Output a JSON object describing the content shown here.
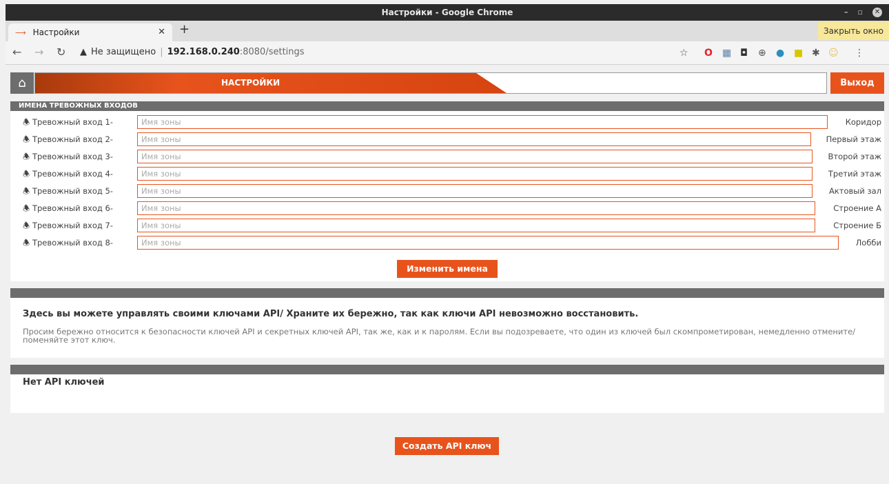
{
  "window": {
    "title": "Настройки - Google Chrome"
  },
  "tab": {
    "label": "Настройки",
    "favicon": "orange-arrow-icon"
  },
  "tabbar": {
    "close_window": "Закрыть окно"
  },
  "address": {
    "security": "Не защищено",
    "host": "192.168.0.240",
    "path": ":8080/settings"
  },
  "header": {
    "title": "НАСТРОЙКИ",
    "logout": "Выход"
  },
  "zones": {
    "heading": "ИМЕНА ТРЕВОЖНЫХ ВХОДОВ",
    "placeholder": "Имя зоны",
    "rows": [
      {
        "label": "Тревожный вход 1-",
        "value": "Коридор"
      },
      {
        "label": "Тревожный вход 2-",
        "value": "Первый этаж"
      },
      {
        "label": "Тревожный вход 3-",
        "value": "Второй этаж"
      },
      {
        "label": "Тревожный вход 4-",
        "value": "Третий этаж"
      },
      {
        "label": "Тревожный вход 5-",
        "value": "Актовый зал"
      },
      {
        "label": "Тревожный вход 6-",
        "value": "Строение А"
      },
      {
        "label": "Тревожный вход 7-",
        "value": "Строение Б"
      },
      {
        "label": "Тревожный вход 8-",
        "value": "Лобби"
      }
    ],
    "save_button": "Изменить имена"
  },
  "api": {
    "heading": "Здесь вы можете управлять своими ключами API/ Храните их бережно, так как ключи API невозможно восстановить.",
    "text": "Просим бережно относится к безопасности ключей API и секретных ключей API, так же, как и к паролям. Если вы подозреваете, что один из ключей был скомпрометирован, немедленно отмените/поменяйте этот ключ.",
    "no_keys": "Нет API ключей",
    "create_button": "Создать API ключ"
  },
  "colors": {
    "accent": "#e8531c",
    "header_gray": "#6d6d6d"
  }
}
